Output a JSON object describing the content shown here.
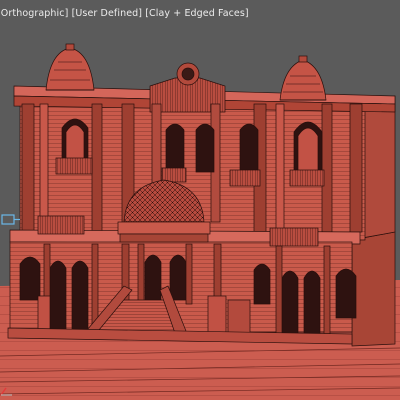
{
  "viewport": {
    "menu_view": "[Orthographic]",
    "menu_camera": "[User Defined]",
    "menu_shading": "[Clay + Edged Faces]"
  },
  "scene": {
    "object": "palace-building-model",
    "shading_color": "#c9584a",
    "edge_color": "#2a0f0c",
    "background_color": "#5b5b5b"
  },
  "icons": [
    "viewport-gizmo-icon",
    "axis-tripod-icon"
  ]
}
